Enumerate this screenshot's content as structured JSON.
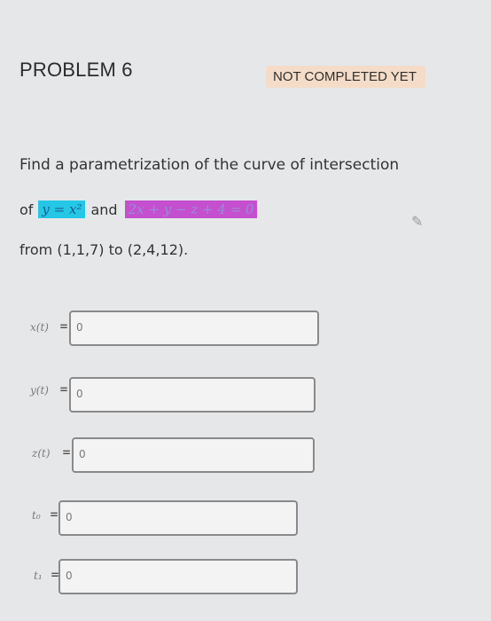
{
  "problem": {
    "title": "PROBLEM 6",
    "status": "NOT COMPLETED YET"
  },
  "question": {
    "line1": "Find a parametrization of the curve of intersection",
    "of_word": "of",
    "eq1": "y = x²",
    "and_word": "and",
    "eq2": "2x + y − z + 4 = 0",
    "line3": "from (1,1,7) to (2,4,12)."
  },
  "fields": [
    {
      "label": "x(t)",
      "value": "0"
    },
    {
      "label": "y(t)",
      "value": "0"
    },
    {
      "label": "z(t)",
      "value": "0"
    },
    {
      "label": "t₀",
      "value": "0"
    },
    {
      "label": "t₁",
      "value": "0"
    }
  ]
}
